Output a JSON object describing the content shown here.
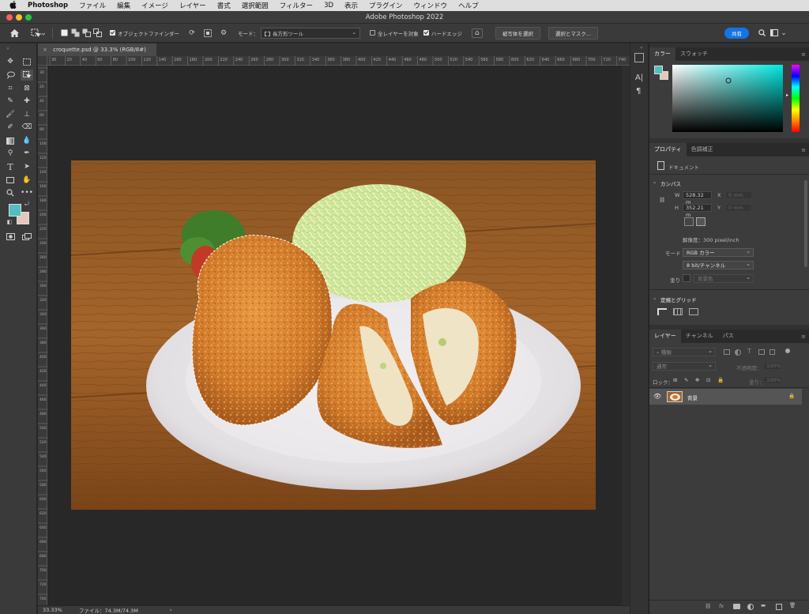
{
  "menubar": {
    "apple": "",
    "items": [
      "Photoshop",
      "ファイル",
      "編集",
      "イメージ",
      "レイヤー",
      "書式",
      "選択範囲",
      "フィルター",
      "3D",
      "表示",
      "プラグイン",
      "ウィンドウ",
      "ヘルプ"
    ]
  },
  "window": {
    "title": "Adobe Photoshop 2022"
  },
  "options": {
    "object_finder": "オブジェクトファインダー",
    "mode_label": "モード：",
    "mode_value": "長方形ツール",
    "all_layers": "全レイヤーを対象",
    "hard_edge": "ハードエッジ",
    "select_subject": "被写体を選択",
    "select_mask": "選択とマスク...",
    "share": "共有"
  },
  "document": {
    "tab_label": "croquette.psd @ 33.3% (RGB/8#)",
    "ruler_ticks": [
      "30",
      "20",
      "40",
      "60",
      "80",
      "100",
      "120",
      "140",
      "160",
      "180",
      "200",
      "220",
      "240",
      "260",
      "280",
      "300",
      "320",
      "340",
      "360",
      "380",
      "400",
      "420",
      "440",
      "460",
      "480",
      "500",
      "520",
      "540",
      "560",
      "580",
      "600",
      "620",
      "640",
      "660",
      "680",
      "700",
      "720",
      "740"
    ],
    "ruler_v_ticks": [
      "30",
      "20",
      "40",
      "60",
      "80",
      "100",
      "120",
      "140",
      "160",
      "180",
      "200",
      "220",
      "240",
      "260",
      "280",
      "300",
      "320",
      "340",
      "360",
      "380",
      "400",
      "420",
      "440",
      "460",
      "480",
      "500",
      "520",
      "540",
      "560",
      "580",
      "600",
      "620",
      "640",
      "660",
      "680",
      "700",
      "720",
      "740"
    ]
  },
  "status": {
    "zoom": "33.33%",
    "file": "ファイル：74.3M/74.3M",
    "arrow": "›"
  },
  "color_panel": {
    "tabs": [
      "カラー",
      "スウォッチ"
    ],
    "foreground": "#52bec1",
    "background": "#e4c8bb"
  },
  "properties": {
    "tabs": [
      "プロパティ",
      "色調補正"
    ],
    "doc_label": "ドキュメント",
    "canvas_section": "カンバス",
    "w_label": "W",
    "w_value": "528.32 m",
    "h_label": "H",
    "h_value": "352.21 m",
    "x_label": "X",
    "x_value": "0 mm",
    "y_label": "Y",
    "y_value": "0 mm",
    "resolution": "解像度：300 pixel/inch",
    "mode_label": "モード",
    "mode_value": "RGB カラー",
    "depth_value": "8 bit/チャンネル",
    "fill_label": "塗り",
    "fill_value": "背景色",
    "guides_section": "定規とグリッド"
  },
  "layers": {
    "tabs": [
      "レイヤー",
      "チャンネル",
      "パス"
    ],
    "kind": "種類",
    "blend": "通常",
    "opacity_label": "不透明度：",
    "opacity_value": "100%",
    "lock_label": "ロック：",
    "fill_label": "塗り：",
    "fill_value": "100%",
    "items": [
      {
        "name": "背景",
        "visible": true,
        "locked": true
      }
    ]
  },
  "colors": {
    "accent": "#1473e6",
    "panel": "#323232",
    "canvas": "#282828"
  }
}
